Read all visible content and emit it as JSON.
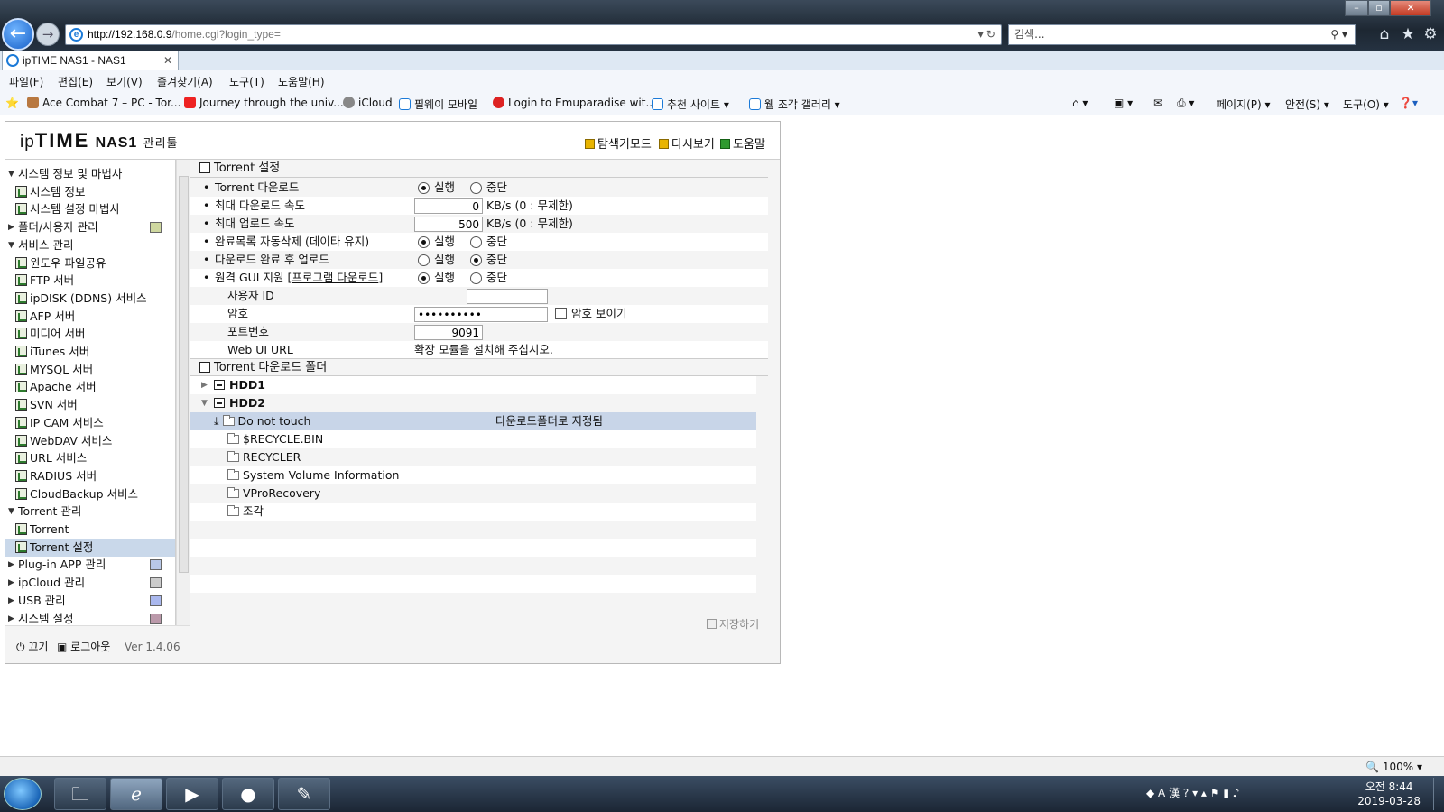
{
  "browser": {
    "address_host": "http://192.168.0.9",
    "address_rest": "/home.cgi?login_type=",
    "search_placeholder": "검색...",
    "tab_title": "ipTIME NAS1 - NAS1",
    "tab_close": "✕",
    "menus": [
      "파일(F)",
      "편집(E)",
      "보기(V)",
      "즐겨찾기(A)",
      "도구(T)",
      "도움말(H)"
    ],
    "favorites": [
      "Ace Combat 7 – PC - Tor...",
      "Journey through the univ...",
      "iCloud",
      "필웨이 모바일",
      "Login to Emuparadise wit...",
      "추천 사이트 ▾",
      "웹 조각 갤러리 ▾"
    ],
    "commands": [
      "페이지(P) ▾",
      "안전(S) ▾",
      "도구(O) ▾"
    ],
    "zoom": "100%"
  },
  "app": {
    "logo_ip": "ip",
    "logo_time": "TIME",
    "logo_nas": "NAS1",
    "logo_admin": "관리툴",
    "header_links": [
      "탐색기모드",
      "다시보기",
      "도움말"
    ],
    "sidebar": [
      {
        "label": "시스템 정보 및 마법사",
        "type": "group",
        "open": true
      },
      {
        "label": "시스템 정보",
        "type": "item"
      },
      {
        "label": "시스템 설정 마법사",
        "type": "item"
      },
      {
        "label": "폴더/사용자 관리",
        "type": "group",
        "open": false
      },
      {
        "label": "서비스 관리",
        "type": "group",
        "open": true
      },
      {
        "label": "윈도우 파일공유",
        "type": "item"
      },
      {
        "label": "FTP 서버",
        "type": "item"
      },
      {
        "label": "ipDISK (DDNS) 서비스",
        "type": "item"
      },
      {
        "label": "AFP 서버",
        "type": "item"
      },
      {
        "label": "미디어 서버",
        "type": "item"
      },
      {
        "label": "iTunes 서버",
        "type": "item"
      },
      {
        "label": "MYSQL 서버",
        "type": "item"
      },
      {
        "label": "Apache 서버",
        "type": "item"
      },
      {
        "label": "SVN 서버",
        "type": "item"
      },
      {
        "label": "IP CAM 서비스",
        "type": "item"
      },
      {
        "label": "WebDAV 서비스",
        "type": "item"
      },
      {
        "label": "URL 서비스",
        "type": "item"
      },
      {
        "label": "RADIUS 서버",
        "type": "item"
      },
      {
        "label": "CloudBackup 서비스",
        "type": "item"
      },
      {
        "label": "Torrent 관리",
        "type": "group",
        "open": true
      },
      {
        "label": "Torrent",
        "type": "item"
      },
      {
        "label": "Torrent 설정",
        "type": "item",
        "selected": true
      },
      {
        "label": "Plug-in APP 관리",
        "type": "group",
        "open": false
      },
      {
        "label": "ipCloud 관리",
        "type": "group",
        "open": false
      },
      {
        "label": "USB 관리",
        "type": "group",
        "open": false
      },
      {
        "label": "시스템 설정",
        "type": "group",
        "open": false
      }
    ],
    "footer": {
      "power": "끄기",
      "logout": "로그아웃",
      "version": "Ver 1.4.06"
    },
    "section_settings": "Torrent 설정",
    "settings": {
      "torrent_download": {
        "label": "Torrent 다운로드",
        "on": "실행",
        "off": "중단",
        "selected": "on"
      },
      "max_down": {
        "label": "최대 다운로드 속도",
        "value": "0",
        "unit": "KB/s (0 : 무제한)"
      },
      "max_up": {
        "label": "최대 업로드 속도",
        "value": "500",
        "unit": "KB/s (0 : 무제한)"
      },
      "auto_delete": {
        "label": "완료목록 자동삭제 (데이타 유지)",
        "on": "실행",
        "off": "중단",
        "selected": "on"
      },
      "upload_after": {
        "label": "다운로드 완료 후 업로드",
        "on": "실행",
        "off": "중단",
        "selected": "off"
      },
      "remote_gui": {
        "label": "원격 GUI 지원 [",
        "link": "프로그램 다운로드",
        "label_end": "]",
        "on": "실행",
        "off": "중단",
        "selected": "on"
      },
      "user_id": {
        "label": "사용자 ID",
        "value": ""
      },
      "password": {
        "label": "암호",
        "value": "••••••••••",
        "show_label": "암호 보이기"
      },
      "port": {
        "label": "포트번호",
        "value": "9091"
      },
      "web_ui": {
        "label": "Web UI URL",
        "value": "확장 모듈을 설치해 주십시오."
      }
    },
    "section_folder": "Torrent 다운로드 폴더",
    "tree": {
      "hdd1": "HDD1",
      "hdd2": "HDD2",
      "selected_folder": "Do not touch",
      "selected_note": "다운로드폴더로 지정됨",
      "folders": [
        "$RECYCLE.BIN",
        "RECYCLER",
        "System Volume Information",
        "VProRecovery",
        "조각"
      ]
    },
    "save": "저장하기"
  },
  "taskbar": {
    "time": "오전 8:44",
    "date": "2019-03-28"
  }
}
